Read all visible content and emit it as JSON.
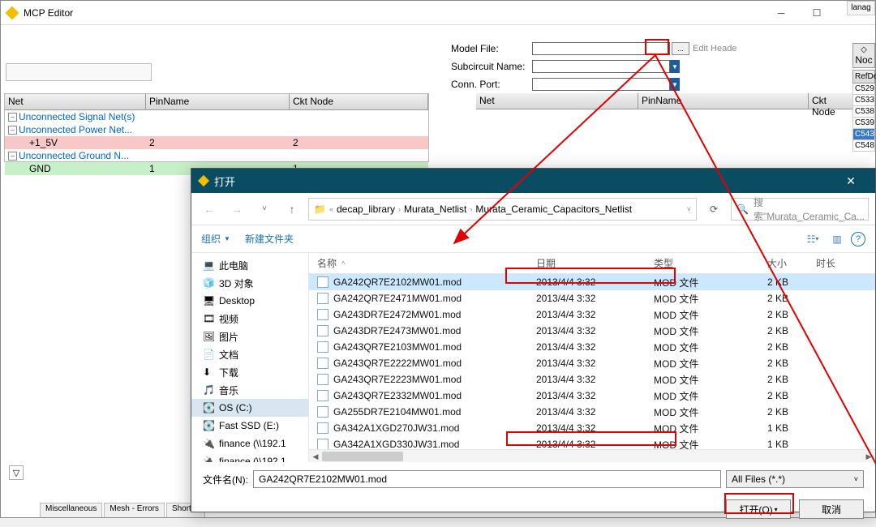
{
  "main": {
    "title": "MCP Editor",
    "manag_tab": "lanag"
  },
  "form": {
    "model_file": "Model File:",
    "subcircuit": "Subcircuit Name:",
    "conn_port": "Conn. Port:",
    "edit_header": "Edit Heade"
  },
  "grid": {
    "h_net": "Net",
    "h_pin": "PinName",
    "h_ckt": "Ckt Node",
    "r0": "Unconnected Signal Net(s)",
    "r1": "Unconnected Power Net...",
    "r2_name": "+1_5V",
    "r2_pin": "2",
    "r2_ckt": "2",
    "r3": "Unconnected Ground N...",
    "r4_name": "GND",
    "r4_pin": "1",
    "r4_ckt": "1"
  },
  "side": {
    "noc": "Noc",
    "refde": "RefDe",
    "rows": [
      "C529",
      "C533",
      "C538",
      "C539",
      "C543",
      "C548"
    ]
  },
  "dialog": {
    "title": "打开",
    "bc": [
      "decap_library",
      "Murata_Netlist",
      "Murata_Ceramic_Capacitors_Netlist"
    ],
    "search_ph": "搜索\"Murata_Ceramic_Ca...",
    "organize": "组织",
    "newfolder": "新建文件夹",
    "sidebar": [
      {
        "label": "此电脑",
        "icon": "pc"
      },
      {
        "label": "3D 对象",
        "icon": "3d"
      },
      {
        "label": "Desktop",
        "icon": "desktop"
      },
      {
        "label": "视频",
        "icon": "video"
      },
      {
        "label": "图片",
        "icon": "pic"
      },
      {
        "label": "文档",
        "icon": "doc"
      },
      {
        "label": "下载",
        "icon": "dl"
      },
      {
        "label": "音乐",
        "icon": "music"
      },
      {
        "label": "OS (C:)",
        "icon": "disk",
        "selected": true
      },
      {
        "label": "Fast SSD (E:)",
        "icon": "disk"
      },
      {
        "label": "finance (\\\\192.1",
        "icon": "netx"
      },
      {
        "label": "finance (\\\\192.1",
        "icon": "netx"
      }
    ],
    "cols": {
      "name": "名称",
      "date": "日期",
      "type": "类型",
      "size": "大小",
      "dur": "时长"
    },
    "files": [
      {
        "n": "GA242QR7E2102MW01.mod",
        "d": "2013/4/4 3:32",
        "t": "MOD 文件",
        "s": "2 KB",
        "sel": true
      },
      {
        "n": "GA242QR7E2471MW01.mod",
        "d": "2013/4/4 3:32",
        "t": "MOD 文件",
        "s": "2 KB"
      },
      {
        "n": "GA243DR7E2472MW01.mod",
        "d": "2013/4/4 3:32",
        "t": "MOD 文件",
        "s": "2 KB"
      },
      {
        "n": "GA243DR7E2473MW01.mod",
        "d": "2013/4/4 3:32",
        "t": "MOD 文件",
        "s": "2 KB"
      },
      {
        "n": "GA243QR7E2103MW01.mod",
        "d": "2013/4/4 3:32",
        "t": "MOD 文件",
        "s": "2 KB"
      },
      {
        "n": "GA243QR7E2222MW01.mod",
        "d": "2013/4/4 3:32",
        "t": "MOD 文件",
        "s": "2 KB"
      },
      {
        "n": "GA243QR7E2223MW01.mod",
        "d": "2013/4/4 3:32",
        "t": "MOD 文件",
        "s": "2 KB"
      },
      {
        "n": "GA243QR7E2332MW01.mod",
        "d": "2013/4/4 3:32",
        "t": "MOD 文件",
        "s": "2 KB"
      },
      {
        "n": "GA255DR7E2104MW01.mod",
        "d": "2013/4/4 3:32",
        "t": "MOD 文件",
        "s": "2 KB"
      },
      {
        "n": "GA342A1XGD270JW31.mod",
        "d": "2013/4/4 3:32",
        "t": "MOD 文件",
        "s": "1 KB"
      },
      {
        "n": "GA342A1XGD330JW31.mod",
        "d": "2013/4/4 3:32",
        "t": "MOD 文件",
        "s": "1 KB"
      }
    ],
    "fn_label": "文件名(N):",
    "fn_value": "GA242QR7E2102MW01.mod",
    "filter": "All Files (*.*)",
    "open": "打开(O)",
    "cancel": "取消"
  },
  "tabs": [
    "Miscellaneous",
    "Mesh - Errors",
    "Short C"
  ]
}
